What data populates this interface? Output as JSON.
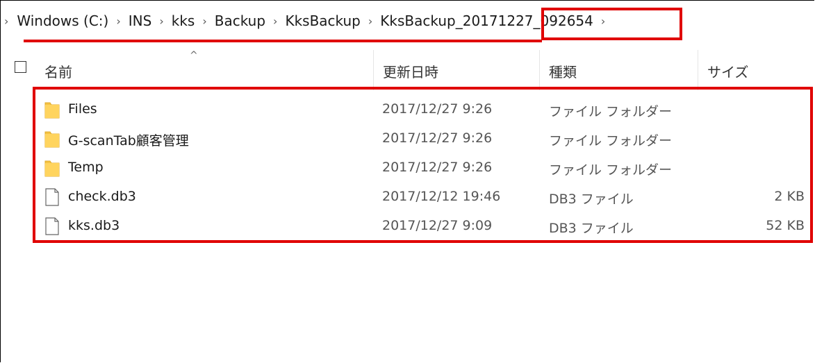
{
  "breadcrumb": {
    "items": [
      "Windows (C:)",
      "INS",
      "kks",
      "Backup",
      "KksBackup",
      "KksBackup_20171227_092654"
    ]
  },
  "header": {
    "columns": [
      "名前",
      "更新日時",
      "種類",
      "サイズ"
    ],
    "sort_indicator": "^"
  },
  "files": [
    {
      "name": "Files",
      "modified": "2017/12/27 9:26",
      "type": "ファイル フォルダー",
      "size": "",
      "icon": "folder-icon"
    },
    {
      "name": "G-scanTab顧客管理",
      "modified": "2017/12/27 9:26",
      "type": "ファイル フォルダー",
      "size": "",
      "icon": "folder-icon"
    },
    {
      "name": "Temp",
      "modified": "2017/12/27 9:26",
      "type": "ファイル フォルダー",
      "size": "",
      "icon": "folder-icon"
    },
    {
      "name": "check.db3",
      "modified": "2017/12/12 19:46",
      "type": "DB3 ファイル",
      "size": "2 KB",
      "icon": "file-icon"
    },
    {
      "name": "kks.db3",
      "modified": "2017/12/27 9:09",
      "type": "DB3 ファイル",
      "size": "52 KB",
      "icon": "file-icon"
    }
  ],
  "colors": {
    "highlight": "#e00000",
    "folder": "#f5c344"
  }
}
